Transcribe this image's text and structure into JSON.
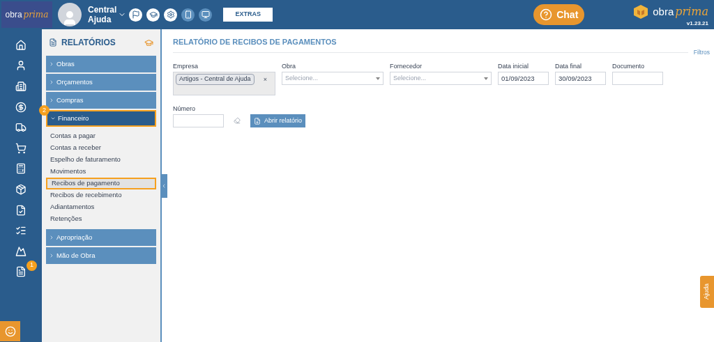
{
  "topbar": {
    "logo": {
      "word": "obra",
      "script": "prima"
    },
    "user": {
      "first": "Central",
      "second": "Ajuda"
    },
    "extras_button": "EXTRAS",
    "chat_button": "Chat",
    "brand": {
      "word": "obra",
      "script": "prima",
      "version": "v1.23.21"
    }
  },
  "rail": {
    "badge": "1"
  },
  "sidebar": {
    "title": "RELATÓRIOS",
    "groups": [
      {
        "label": "Obras",
        "expanded": false,
        "highlighted": false
      },
      {
        "label": "Orçamentos",
        "expanded": false,
        "highlighted": false
      },
      {
        "label": "Compras",
        "expanded": false,
        "highlighted": false
      },
      {
        "label": "Financeiro",
        "expanded": true,
        "highlighted": true,
        "badge": "2",
        "children": [
          {
            "label": "Contas a pagar",
            "selected": false
          },
          {
            "label": "Contas a receber",
            "selected": false
          },
          {
            "label": "Espelho de faturamento",
            "selected": false
          },
          {
            "label": "Movimentos",
            "selected": false
          },
          {
            "label": "Recibos de pagamento",
            "selected": true
          },
          {
            "label": "Recibos de recebimento",
            "selected": false
          },
          {
            "label": "Adiantamentos",
            "selected": false
          },
          {
            "label": "Retenções",
            "selected": false
          }
        ]
      },
      {
        "label": "Apropriação",
        "expanded": false,
        "highlighted": false
      },
      {
        "label": "Mão de Obra",
        "expanded": false,
        "highlighted": false
      }
    ]
  },
  "main": {
    "title": "RELATÓRIO DE RECIBOS DE PAGAMENTOS",
    "filters_link": "Filtros",
    "fields": [
      {
        "kind": "multi",
        "label": "Empresa",
        "tags": [
          "Artigos - Central de Ajuda"
        ],
        "remove": "×"
      },
      {
        "kind": "select",
        "label": "Obra",
        "placeholder": "Selecione..."
      },
      {
        "kind": "select",
        "label": "Fornecedor",
        "placeholder": "Selecione..."
      },
      {
        "kind": "text",
        "label": "Data inicial",
        "value": "01/09/2023"
      },
      {
        "kind": "text",
        "label": "Data final",
        "value": "30/09/2023"
      },
      {
        "kind": "text",
        "label": "Documento"
      }
    ],
    "number_field": {
      "label": "Número"
    },
    "open_button": "Abrir relatório"
  },
  "help_tab": "Ajuda"
}
